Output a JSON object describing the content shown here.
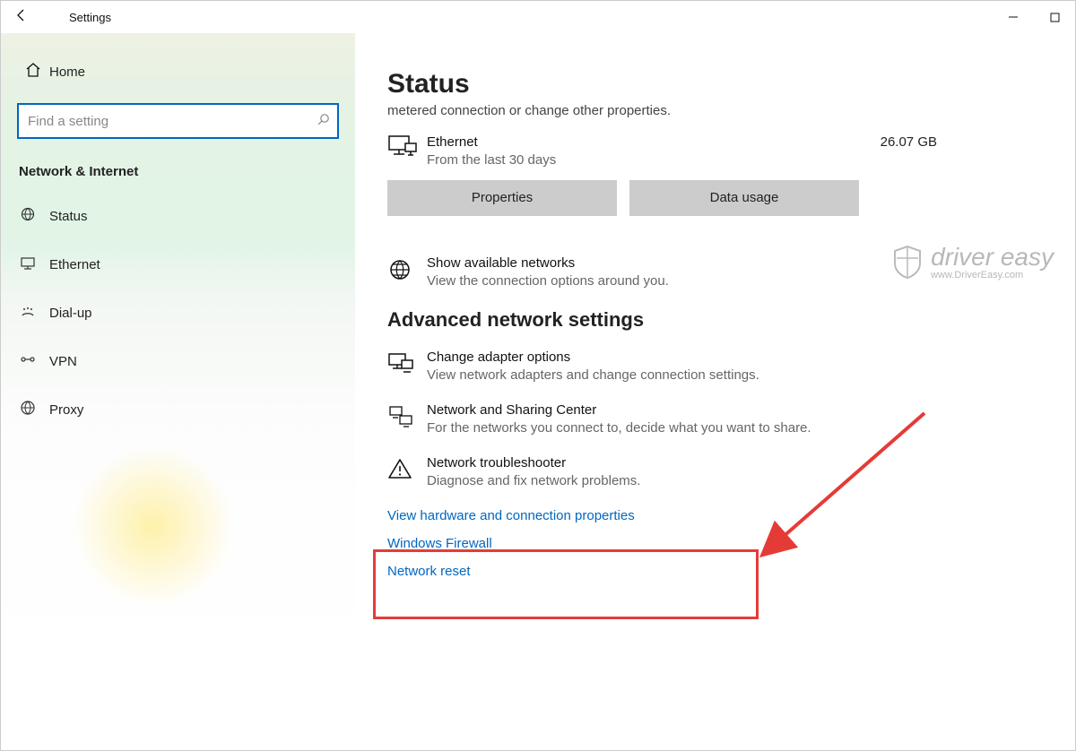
{
  "window": {
    "title": "Settings"
  },
  "sidebar": {
    "home_label": "Home",
    "search_placeholder": "Find a setting",
    "section_label": "Network & Internet",
    "nav": [
      {
        "label": "Status"
      },
      {
        "label": "Ethernet"
      },
      {
        "label": "Dial-up"
      },
      {
        "label": "VPN"
      },
      {
        "label": "Proxy"
      }
    ]
  },
  "main": {
    "title": "Status",
    "clipped_text": "metered connection or change other properties.",
    "ethernet": {
      "name": "Ethernet",
      "subtext": "From the last 30 days",
      "usage": "26.07 GB"
    },
    "buttons": {
      "properties": "Properties",
      "data_usage": "Data usage"
    },
    "available_networks": {
      "title": "Show available networks",
      "subtitle": "View the connection options around you."
    },
    "advanced_header": "Advanced network settings",
    "change_adapter": {
      "title": "Change adapter options",
      "subtitle": "View network adapters and change connection settings."
    },
    "sharing_center": {
      "title": "Network and Sharing Center",
      "subtitle": "For the networks you connect to, decide what you want to share."
    },
    "troubleshooter": {
      "title": "Network troubleshooter",
      "subtitle": "Diagnose and fix network problems."
    },
    "links": {
      "hardware": "View hardware and connection properties",
      "firewall": "Windows Firewall",
      "reset": "Network reset"
    }
  },
  "watermark": {
    "brand": "driver easy",
    "url": "www.DriverEasy.com"
  }
}
